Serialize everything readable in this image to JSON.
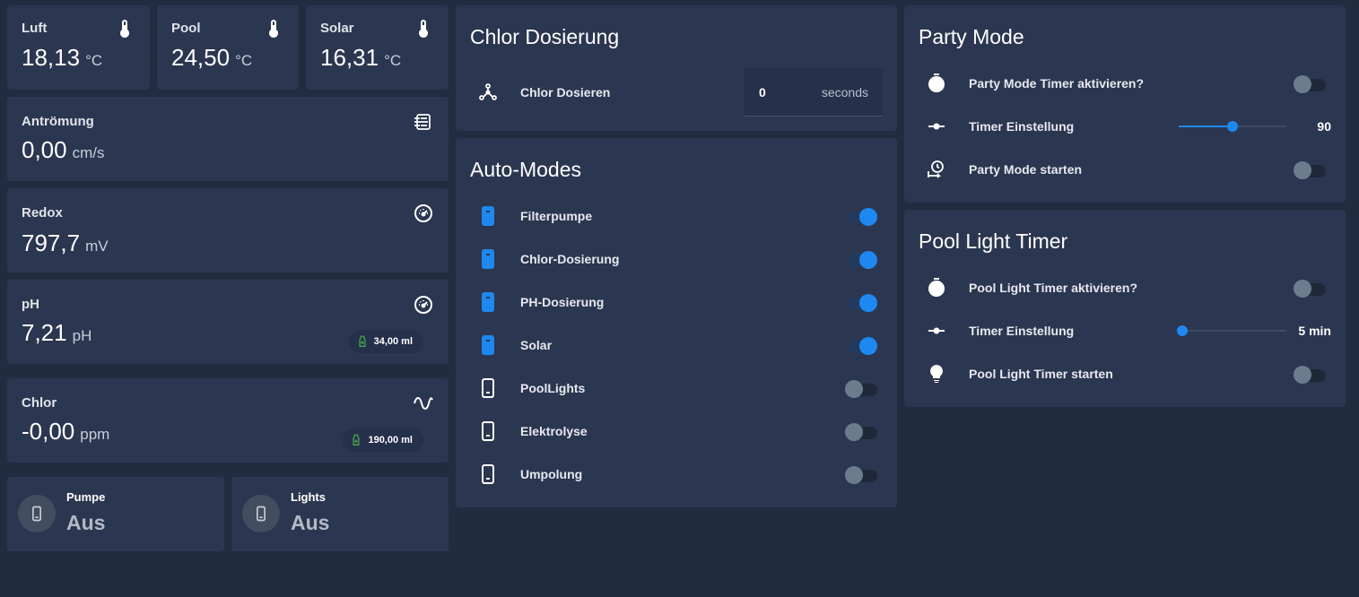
{
  "sensors": {
    "luft": {
      "label": "Luft",
      "value": "18,13",
      "unit": "°C",
      "icon": "thermometer-icon"
    },
    "pool": {
      "label": "Pool",
      "value": "24,50",
      "unit": "°C",
      "icon": "thermometer-icon"
    },
    "solar": {
      "label": "Solar",
      "value": "16,31",
      "unit": "°C",
      "icon": "thermometer-icon"
    },
    "antroemung": {
      "label": "Antrömung",
      "value": "0,00",
      "unit": "cm/s",
      "icon": "flow-icon"
    },
    "redox": {
      "label": "Redox",
      "value": "797,7",
      "unit": "mV",
      "icon": "gauge-icon"
    },
    "ph": {
      "label": "pH",
      "value": "7,21",
      "unit": "pH",
      "icon": "gauge-icon",
      "badge": "34,00 ml"
    },
    "chlor": {
      "label": "Chlor",
      "value": "-0,00",
      "unit": "ppm",
      "icon": "sine-wave-icon",
      "badge": "190,00 ml"
    }
  },
  "tiles": {
    "pumpe": {
      "name": "Pumpe",
      "state": "Aus",
      "icon": "phone-icon"
    },
    "lights": {
      "name": "Lights",
      "state": "Aus",
      "icon": "phone-icon"
    }
  },
  "chlor_dosierung": {
    "title": "Chlor Dosierung",
    "row": {
      "name": "Chlor Dosieren",
      "value": "0",
      "suffix": "seconds",
      "icon": "molecule-icon"
    }
  },
  "auto_modes": {
    "title": "Auto-Modes",
    "items": [
      {
        "name": "Filterpumpe",
        "on": true
      },
      {
        "name": "Chlor-Dosierung",
        "on": true
      },
      {
        "name": "PH-Dosierung",
        "on": true
      },
      {
        "name": "Solar",
        "on": true
      },
      {
        "name": "PoolLights",
        "on": false
      },
      {
        "name": "Elektrolyse",
        "on": false
      },
      {
        "name": "Umpolung",
        "on": false
      }
    ]
  },
  "party_mode": {
    "title": "Party Mode",
    "timer_activate": {
      "name": "Party Mode Timer aktivieren?",
      "on": false,
      "icon": "timer-icon"
    },
    "timer_setting": {
      "name": "Timer Einstellung",
      "value": "90",
      "fraction": 0.5,
      "icon": "slider-icon"
    },
    "start": {
      "name": "Party Mode starten",
      "on": false,
      "icon": "clock-start-icon"
    }
  },
  "pool_light_timer": {
    "title": "Pool Light Timer",
    "timer_activate": {
      "name": "Pool Light Timer aktivieren?",
      "on": false,
      "icon": "timer-icon"
    },
    "timer_setting": {
      "name": "Timer Einstellung",
      "value": "5 min",
      "fraction": 0.03,
      "icon": "slider-icon"
    },
    "start": {
      "name": "Pool Light Timer starten",
      "on": false,
      "icon": "lightbulb-icon"
    }
  },
  "colors": {
    "background": "#222c40",
    "card": "#2b3650",
    "accent": "#1e88f0",
    "toggle_off": "#6b7c8f",
    "badge_icon": "#4caf50"
  }
}
